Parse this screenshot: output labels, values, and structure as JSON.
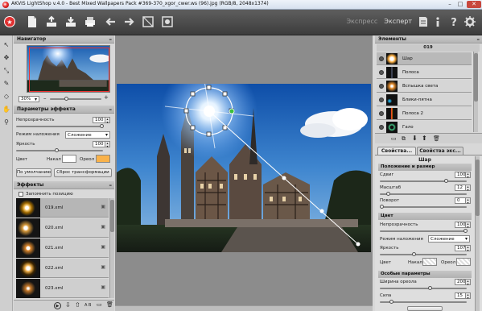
{
  "window": {
    "title": "AKVIS LightShop v.4.0 - Best Mixed Wallpapers Pack #369-370_xgor_cwer.ws (96).jpg (RGB/8, 2048x1374)",
    "controls": {
      "minimize": "–",
      "maximize": "□",
      "close": "✕"
    }
  },
  "toolbar": {
    "icons": [
      "home-icon",
      "open-file-icon",
      "save-file-icon",
      "export-icon",
      "print-icon",
      "undo-icon",
      "redo-icon",
      "before-icon",
      "after-icon"
    ],
    "mode_express": "Экспресс",
    "mode_expert": "Эксперт",
    "right_icons": [
      "presets-icon",
      "info-icon",
      "help-icon",
      "settings-icon"
    ]
  },
  "navigator": {
    "title": "Навигатор",
    "zoom": "30%"
  },
  "effect_params": {
    "title": "Параметры эффекта",
    "opacity_label": "Непрозрачность",
    "opacity_value": "100",
    "blend_label": "Режим наложения",
    "blend_value": "Сложение",
    "brightness_label": "Яркость",
    "brightness_value": "100",
    "color_label": "Цвет",
    "core_label": "Накал",
    "halo_label": "Ореол",
    "halo_color": "#f9b24a",
    "core_color": "#ffffff",
    "default_button": "По умолчанию",
    "reset_button": "Сброс трансформации"
  },
  "effects": {
    "title": "Эффекты",
    "remember_label": "Запомнить позицию",
    "items": [
      {
        "name": "019.xml",
        "selected": true
      },
      {
        "name": "020.xml",
        "selected": false
      },
      {
        "name": "021.xml",
        "selected": false
      },
      {
        "name": "022.xml",
        "selected": false
      },
      {
        "name": "023.xml",
        "selected": false
      }
    ],
    "bottom_icons": [
      "play-icon",
      "download-icon",
      "upload-icon",
      "ab-icon",
      "folder-icon",
      "trash-icon"
    ],
    "ab_label": "A B"
  },
  "elements": {
    "title": "Элементы",
    "preset": "019",
    "items": [
      {
        "name": "Шар",
        "selected": true
      },
      {
        "name": "Полоса",
        "selected": false
      },
      {
        "name": "Вспышка света",
        "selected": false
      },
      {
        "name": "Блики-пятна",
        "selected": false
      },
      {
        "name": "Полоса 2",
        "selected": false
      },
      {
        "name": "Гало",
        "selected": false
      }
    ]
  },
  "properties": {
    "tab1": "Свойства...",
    "tab2": "Свойства экс...",
    "element_name": "Шар",
    "pos_section": "Положение и размер",
    "shift_label": "Сдвиг",
    "shift_value": "100",
    "scale_label": "Масштаб",
    "scale_value": "12",
    "rotate_label": "Поворот",
    "rotate_value": "0",
    "color_section": "Цвет",
    "opacity_label": "Непрозрачность",
    "opacity_value": "100",
    "blend_label": "Режим наложения",
    "blend_value": "Сложение",
    "brightness_label": "Яркость",
    "brightness_value": "107",
    "color_label": "Цвет",
    "core_label": "Накал",
    "halo_label": "Ореол",
    "special_section": "Особые параметры",
    "halo_width_label": "Ширина ореола",
    "halo_width_value": "200",
    "strength_label": "Сила",
    "strength_value": "15"
  }
}
